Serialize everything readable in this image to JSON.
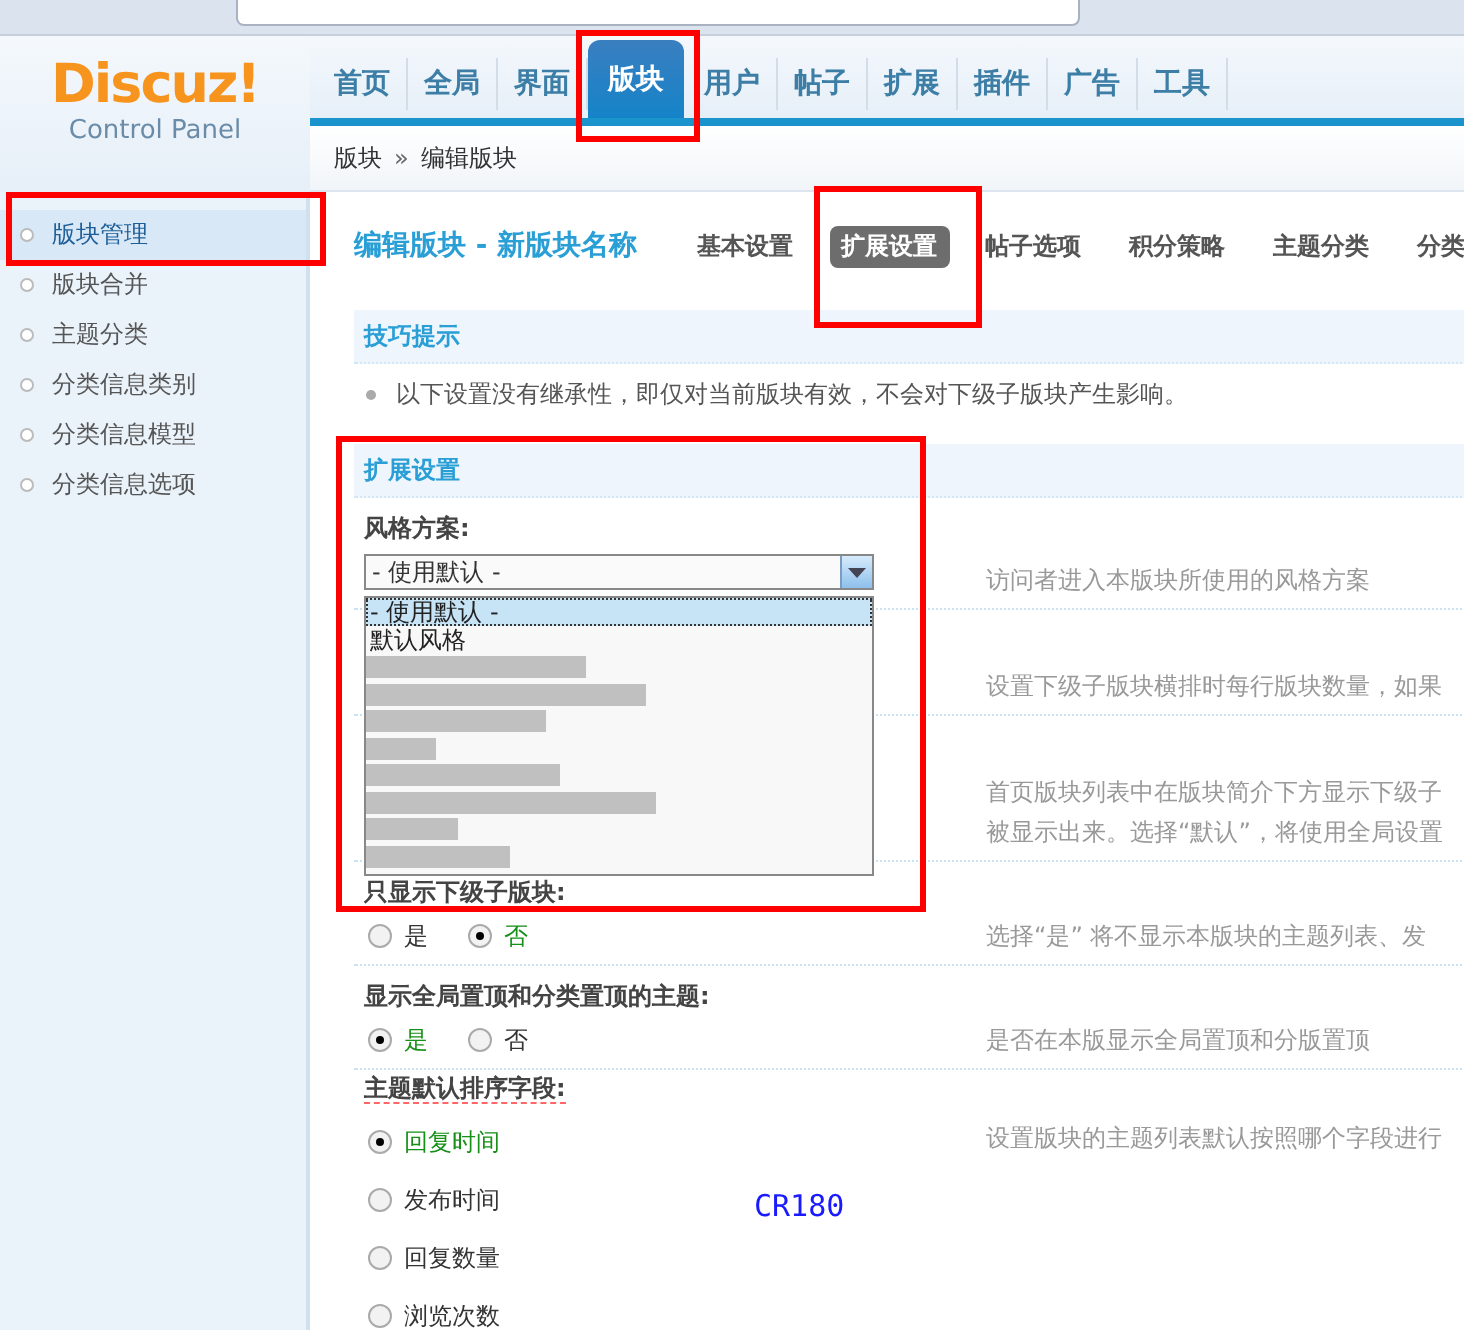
{
  "logo": {
    "name": "Discuz!",
    "subtitle": "Control Panel"
  },
  "nav": [
    {
      "label": "首页",
      "selected": false
    },
    {
      "label": "全局",
      "selected": false
    },
    {
      "label": "界面",
      "selected": false
    },
    {
      "label": "版块",
      "selected": true
    },
    {
      "label": "用户",
      "selected": false
    },
    {
      "label": "帖子",
      "selected": false
    },
    {
      "label": "扩展",
      "selected": false
    },
    {
      "label": "插件",
      "selected": false
    },
    {
      "label": "广告",
      "selected": false
    },
    {
      "label": "工具",
      "selected": false
    }
  ],
  "breadcrumb": {
    "items": [
      "版块",
      "编辑版块"
    ],
    "separator": "»"
  },
  "sidebar": {
    "items": [
      {
        "label": "版块管理",
        "selected": true
      },
      {
        "label": "版块合并",
        "selected": false
      },
      {
        "label": "主题分类",
        "selected": false
      },
      {
        "label": "分类信息类别",
        "selected": false
      },
      {
        "label": "分类信息模型",
        "selected": false
      },
      {
        "label": "分类信息选项",
        "selected": false
      }
    ]
  },
  "page_title": "编辑版块 - 新版块名称",
  "subtabs": [
    {
      "label": "基本设置",
      "selected": false
    },
    {
      "label": "扩展设置",
      "selected": true
    },
    {
      "label": "帖子选项",
      "selected": false
    },
    {
      "label": "积分策略",
      "selected": false
    },
    {
      "label": "主题分类",
      "selected": false
    },
    {
      "label": "分类",
      "selected": false
    }
  ],
  "tips": {
    "title": "技巧提示",
    "text": "以下设置没有继承性，即仅对当前版块有效，不会对下级子版块产生影响。"
  },
  "section_title": "扩展设置",
  "settings": [
    {
      "kind": "select",
      "label": "风格方案:",
      "value": "- 使用默认 -",
      "description": [
        "访问者进入本版块所使用的风格方案"
      ]
    },
    {
      "kind": "hidden",
      "description": [
        "设置下级子版块横排时每行版块数量，如果"
      ]
    },
    {
      "kind": "hidden",
      "description": [
        "首页版块列表中在版块简介下方显示下级子",
        "被显示出来。选择“默认”，将使用全局设置"
      ]
    },
    {
      "kind": "radio",
      "label": "只显示下级子版块:",
      "underline": false,
      "options": [
        {
          "label": "是",
          "selected": false
        },
        {
          "label": "否",
          "selected": true
        }
      ],
      "description": [
        "选择“是” 将不显示本版块的主题列表、发"
      ]
    },
    {
      "kind": "radio",
      "label": "显示全局置顶和分类置顶的主题:",
      "underline": false,
      "options": [
        {
          "label": "是",
          "selected": true
        },
        {
          "label": "否",
          "selected": false
        }
      ],
      "description": [
        "是否在本版显示全局置顶和分版置顶"
      ]
    },
    {
      "kind": "radio_list",
      "label": "主题默认排序字段:",
      "underline": true,
      "options": [
        {
          "label": "回复时间",
          "selected": true
        },
        {
          "label": "发布时间",
          "selected": false
        },
        {
          "label": "回复数量",
          "selected": false
        },
        {
          "label": "浏览次数",
          "selected": false
        }
      ],
      "description": [
        "设置版块的主题列表默认按照哪个字段进行"
      ]
    }
  ],
  "dropdown": {
    "options": [
      {
        "kind": "text",
        "label": "- 使用默认 -",
        "selected": true
      },
      {
        "kind": "text",
        "label": "默认风格",
        "selected": false
      },
      {
        "kind": "redacted"
      },
      {
        "kind": "redacted"
      },
      {
        "kind": "redacted"
      },
      {
        "kind": "redacted"
      },
      {
        "kind": "redacted"
      },
      {
        "kind": "redacted"
      },
      {
        "kind": "redacted"
      },
      {
        "kind": "redacted"
      }
    ]
  },
  "stamp": "CR180"
}
